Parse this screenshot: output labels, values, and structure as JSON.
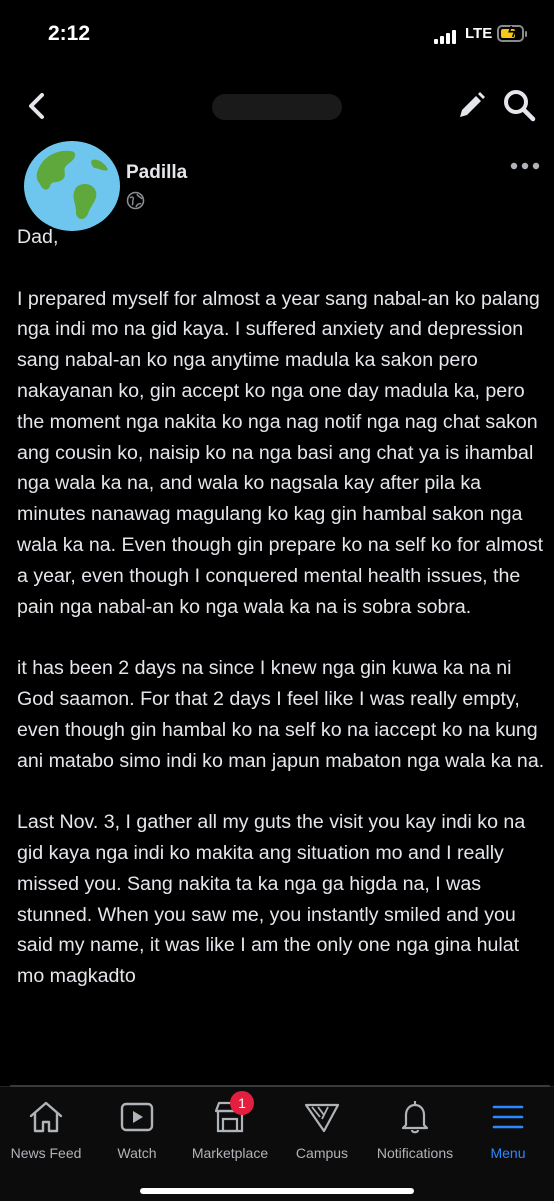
{
  "status": {
    "time": "2:12",
    "network": "LTE"
  },
  "post": {
    "author": "Padilla",
    "paragraphs": [
      "Dad,",
      "I prepared myself for almost a year sang nabal-an ko palang nga indi mo na gid kaya. I suffered anxiety and depression sang nabal-an ko nga anytime madula ka sakon pero nakayanan ko, gin accept ko nga one day madula ka, pero the moment nga nakita ko nga nag notif nga nag chat sakon ang cousin ko, naisip ko na nga basi ang chat ya is ihambal nga wala ka na, and wala ko nagsala kay after pila ka minutes nanawag magulang ko kag gin hambal sakon nga wala ka na. Even though gin prepare ko na self ko for almost a year, even though I conquered mental health issues, the pain nga nabal-an ko nga wala ka na is sobra sobra.",
      "it has been 2 days na since I knew nga gin kuwa ka na ni God saamon. For that 2 days I feel like I was really empty, even though gin hambal ko na self ko na iaccept ko na kung ani matabo simo indi ko man japun mabaton nga wala ka na.",
      "Last Nov. 3, I gather all my guts the visit you kay indi ko na gid kaya nga indi ko makita ang situation mo and I really missed you. Sang nakita ta ka nga ga higda na, I was stunned. When you saw me, you instantly smiled and you said my name, it was like I am the only one nga gina hulat mo magkadto"
    ]
  },
  "bottom_nav": {
    "items": [
      {
        "label": "News Feed",
        "icon": "home-icon"
      },
      {
        "label": "Watch",
        "icon": "video-icon"
      },
      {
        "label": "Marketplace",
        "icon": "shop-icon",
        "badge": "1"
      },
      {
        "label": "Campus",
        "icon": "campus-icon"
      },
      {
        "label": "Notifications",
        "icon": "bell-icon"
      },
      {
        "label": "Menu",
        "icon": "menu-icon",
        "active": true
      }
    ]
  },
  "colors": {
    "background": "#000000",
    "text": "#e4e6eb",
    "accent": "#2d88ff",
    "badge": "#e41e3f"
  }
}
